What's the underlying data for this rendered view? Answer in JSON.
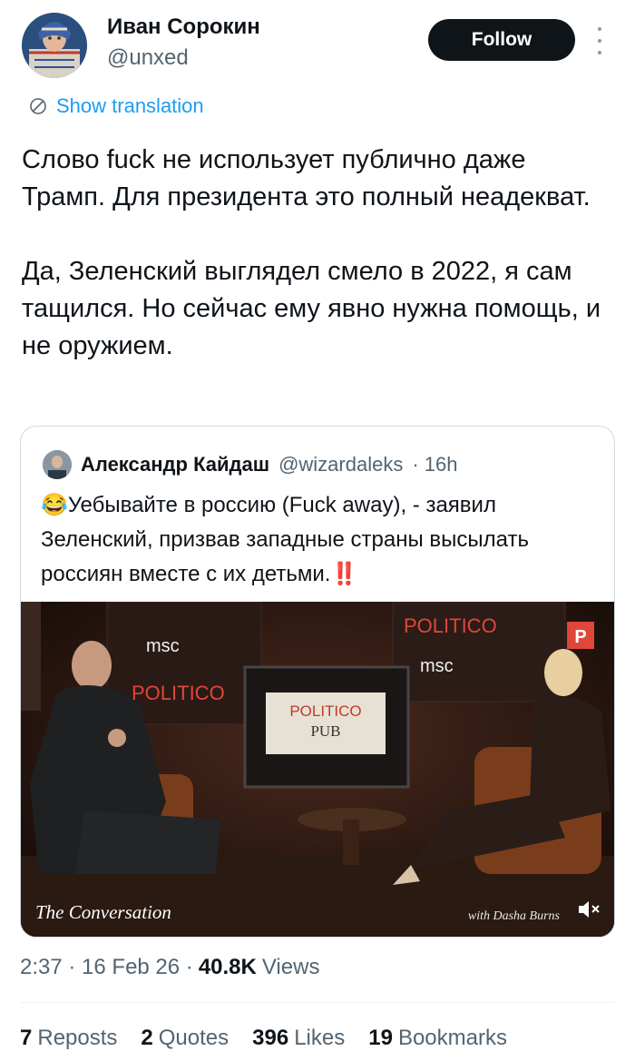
{
  "author": {
    "name": "Иван Сорокин",
    "handle": "@unxed"
  },
  "follow_label": "Follow",
  "show_translation": "Show translation",
  "tweet": {
    "paragraphs": [
      "Слово fuck не использует публично даже Трамп. Для президента это полный неадекват.",
      "Да, Зеленский выглядел смело в 2022, я сам тащился. Но сейчас ему явно нужна помощь, и не оружием."
    ]
  },
  "quoted": {
    "name": "Александр Кайдаш",
    "handle": "@wizardaleks",
    "time": "· 16h",
    "text": "😂Уебывайте в россию (Fuck away), - заявил Зеленский, призвав западные страны высылать россиян вместе с их детьми.‼️",
    "video": {
      "caption_left": "The Conversation",
      "caption_right": "with Dasha Burns",
      "sign_top_left_brand": "msc",
      "sign_top_left_politico": "POLITICO",
      "sign_right_politico": "POLITICO",
      "sign_right_brand": "msc",
      "center_sign_line1": "POLITICO",
      "center_sign_line2": "PUB",
      "corner_badge": "P"
    }
  },
  "meta": {
    "time": "2:37",
    "date": "16 Feb 26",
    "views_count": "40.8K",
    "views_label": "Views"
  },
  "stats": {
    "reposts_count": "7",
    "reposts_label": "Reposts",
    "quotes_count": "2",
    "quotes_label": "Quotes",
    "likes_count": "396",
    "likes_label": "Likes",
    "bookmarks_count": "19",
    "bookmarks_label": "Bookmarks"
  },
  "colors": {
    "accent": "#1d9bf0",
    "text": "#0f1419",
    "muted": "#536471",
    "border": "#cfd9de"
  }
}
